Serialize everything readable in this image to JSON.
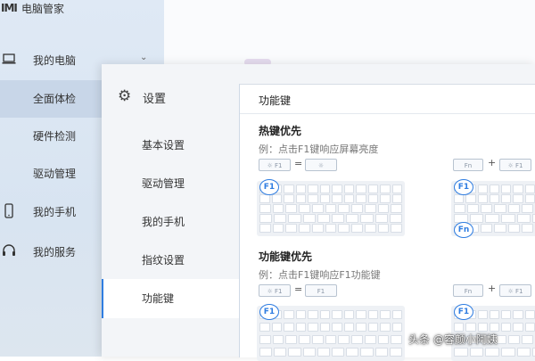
{
  "app": {
    "logo": "ΙΜΙ",
    "title": "电脑管家"
  },
  "sidebar": {
    "items": [
      {
        "label": "我的电脑"
      },
      {
        "label": "全面体检"
      },
      {
        "label": "硬件检测"
      },
      {
        "label": "驱动管理"
      },
      {
        "label": "我的手机"
      },
      {
        "label": "我的服务"
      }
    ]
  },
  "settings": {
    "title": "设置",
    "nav": [
      {
        "label": "基本设置"
      },
      {
        "label": "驱动管理"
      },
      {
        "label": "我的手机"
      },
      {
        "label": "指纹设置"
      },
      {
        "label": "功能键"
      }
    ]
  },
  "content": {
    "header": "功能键",
    "hotkey": {
      "title": "热键优先",
      "desc": "例：点击F1键响应屏幕亮度",
      "key_left": "F1",
      "equals": "=",
      "fn": "Fn",
      "plus": "+",
      "key_right": "F1",
      "badge": "F1",
      "badge_fn": "Fn"
    },
    "fnkey": {
      "title": "功能键优先",
      "desc": "例：点击F1键响应F1功能键",
      "key_left": "F1",
      "equals": "=",
      "result": "F1",
      "fn": "Fn",
      "plus": "+",
      "key_right": "F1",
      "badge": "F1",
      "badge_fn": "F1"
    }
  },
  "watermark": "头条 @容颜小阿姨"
}
